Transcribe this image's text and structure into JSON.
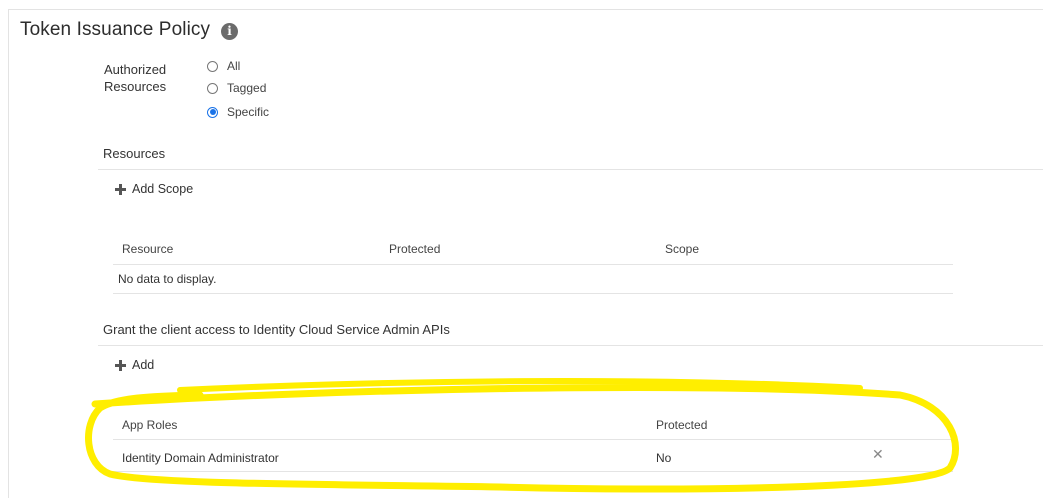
{
  "section": {
    "title": "Token Issuance Policy",
    "info_icon": "info-icon"
  },
  "authorized_resources": {
    "label_line1": "Authorized",
    "label_line2": "Resources",
    "options": [
      {
        "label": "All",
        "selected": false
      },
      {
        "label": "Tagged",
        "selected": false
      },
      {
        "label": "Specific",
        "selected": true
      }
    ]
  },
  "resources": {
    "title": "Resources",
    "add_scope_label": "Add Scope",
    "columns": [
      "Resource",
      "Protected",
      "Scope"
    ],
    "empty_text": "No data to display."
  },
  "admin_apis": {
    "title": "Grant the client access to Identity Cloud Service Admin APIs",
    "add_label": "Add",
    "columns": [
      "App Roles",
      "Protected"
    ],
    "rows": [
      {
        "app_role": "Identity Domain Administrator",
        "protected": "No",
        "remove_icon": "close-icon"
      }
    ]
  },
  "colors": {
    "highlight": "#ffee00",
    "radio_selected": "#1a73e8"
  }
}
